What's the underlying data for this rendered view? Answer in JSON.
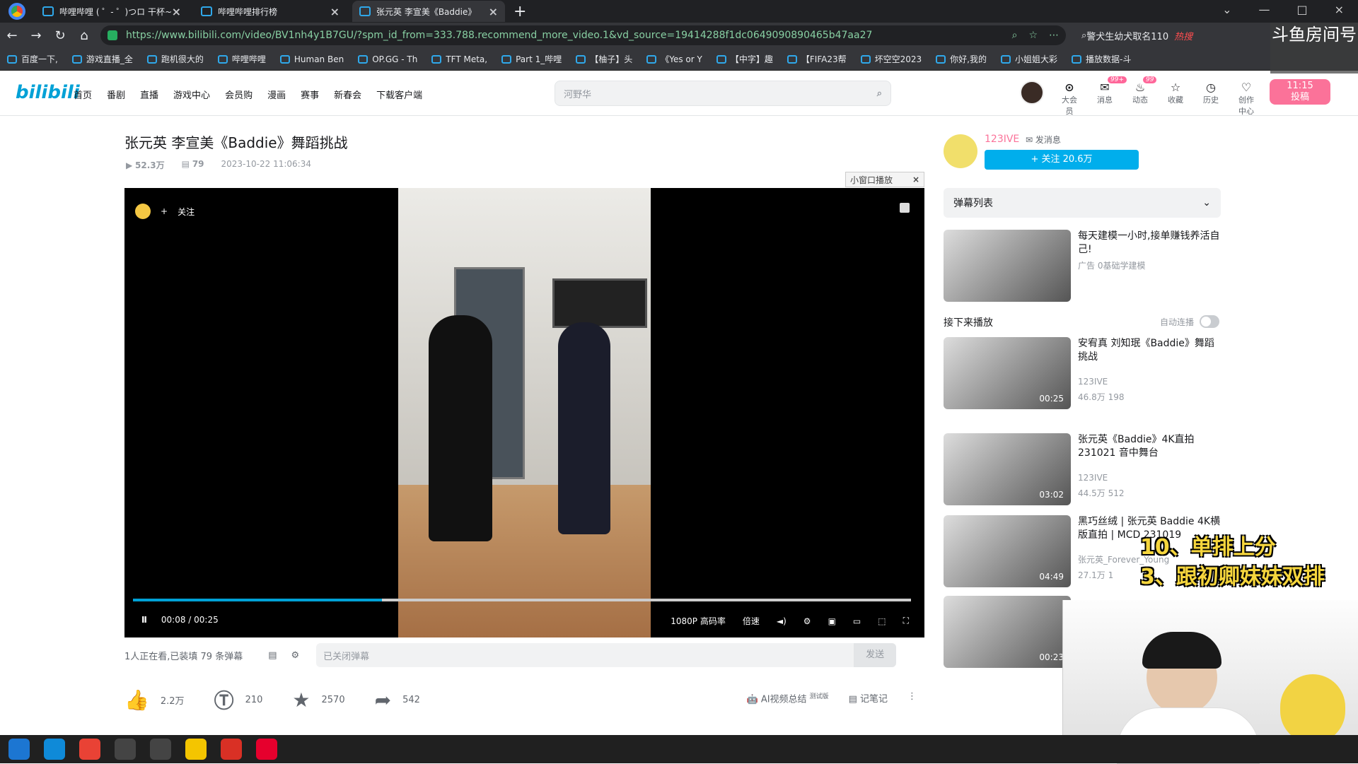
{
  "tabs": [
    {
      "label": "哔哩哔哩 ( ゜- ゜)つロ 干杯~",
      "active": false
    },
    {
      "label": "哔哩哔哩排行榜",
      "active": false
    },
    {
      "label": "张元英 李宣美《Baddie》",
      "active": true
    }
  ],
  "browser": {
    "url": "https://www.bilibili.com/video/BV1nh4y1B7GU/?spm_id_from=333.788.recommend_more_video.1&vd_source=19414288f1dc0649090890465b47aa27",
    "side_search": "警犬生幼犬取名110",
    "hot": "热搜"
  },
  "bookmarks": [
    "百度一下,",
    "游戏直播_全",
    "跑机很大的",
    "哔哩哔哩",
    "Human Ben",
    "OP.GG - Th",
    "TFT Meta,",
    "Part 1_哔哩",
    "【柚子】头",
    "《Yes or Y",
    "【中字】趣",
    "【FIFA23帮",
    "坏空空2023",
    "你好,我的",
    "小姐姐大彩",
    "播放数据-斗"
  ],
  "header": {
    "logo": "bilibili",
    "menu": [
      "首页",
      "番剧",
      "直播",
      "游戏中心",
      "会员购",
      "漫画",
      "赛事",
      "新春会",
      "下载客户端"
    ],
    "search_placeholder": "河野华",
    "user_items": [
      {
        "label": "大会员",
        "icon": "⊙"
      },
      {
        "label": "消息",
        "icon": "✉",
        "badge": "99+"
      },
      {
        "label": "动态",
        "icon": "♨",
        "badge": "99"
      },
      {
        "label": "收藏",
        "icon": "☆"
      },
      {
        "label": "历史",
        "icon": "◷"
      },
      {
        "label": "创作中心",
        "icon": "♡"
      }
    ],
    "upload": "投稿",
    "upload_counter": "11:15"
  },
  "video": {
    "title": "张元英 李宣美《Baddie》舞蹈挑战",
    "views": "52.3万",
    "danmaku": "79",
    "date": "2023-10-22 11:06:34",
    "mini": "小窗口播放",
    "follow": "关注",
    "time": "00:08 / 00:25",
    "progress": 0.32,
    "quality": "1080P 高码率",
    "speed": "倍速"
  },
  "interaction": {
    "watching": "1人正在看,已装填 79 条弹幕",
    "danmaku_placeholder": "已关闭弹幕",
    "send": "发送",
    "likes": "2.2万",
    "coins": "210",
    "favorites": "2570",
    "shares": "542",
    "ai": "AI视频总结",
    "notes": "记笔记",
    "beta": "测试版"
  },
  "uploader": {
    "name": "123IVE",
    "message": "发消息",
    "follow": "+ 关注 20.6万"
  },
  "sidebar": {
    "danmaku_list": "弹幕列表",
    "ad_title": "每天建模一小时,接单赚钱养活自己!",
    "ad_label": "广告",
    "ad_source": "0基础学建模",
    "next": "接下来播放",
    "autoplay": "自动连播",
    "recs": [
      {
        "title": "安宥真 刘知珉《Baddie》舞蹈挑战",
        "author": "123IVE",
        "views": "46.8万",
        "danmaku": "198",
        "duration": "00:25"
      },
      {
        "title": "张元英《Baddie》4K直拍231021 音中舞台",
        "author": "123IVE",
        "views": "44.5万",
        "danmaku": "512",
        "duration": "03:02"
      },
      {
        "title": "黑巧丝绒 | 张元英 Baddie 4K横版直拍 | MCD 231019",
        "author": "张元英_Forever_Young",
        "views": "27.1万",
        "danmaku": "1",
        "duration": "04:49"
      },
      {
        "title": "",
        "author": "",
        "views": "",
        "danmaku": "",
        "duration": "00:23"
      }
    ]
  },
  "stream_overlay": {
    "line1": "10、单排上分",
    "line2": "3、跟初卿妹妹双排",
    "room": "斗鱼房间号"
  }
}
